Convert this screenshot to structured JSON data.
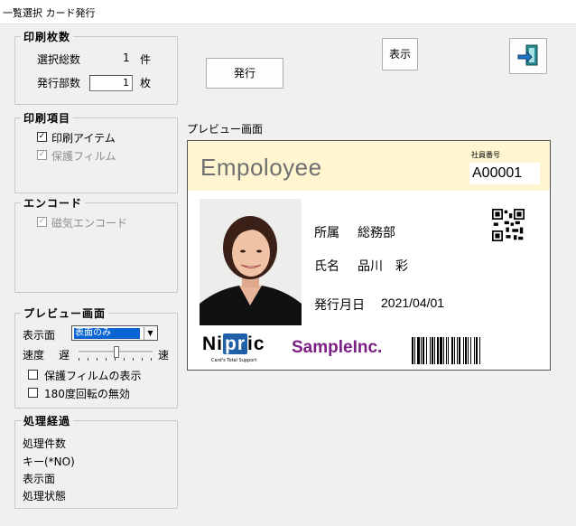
{
  "window": {
    "title": "一覧選択 カード発行"
  },
  "print_count": {
    "title": "印刷枚数",
    "total_label": "選択総数",
    "total_value": "1",
    "total_unit": "件",
    "copies_label": "発行部数",
    "copies_value": "1",
    "copies_unit": "枚"
  },
  "print_items": {
    "title": "印刷項目",
    "items": [
      {
        "label": "印刷アイテム",
        "checked": true,
        "enabled": true
      },
      {
        "label": "保護フィルム",
        "checked": true,
        "enabled": false
      }
    ]
  },
  "encode": {
    "title": "エンコード",
    "items": [
      {
        "label": "磁気エンコード",
        "checked": true,
        "enabled": false
      }
    ]
  },
  "preview_settings": {
    "title": "プレビュー画面",
    "side_label": "表示面",
    "side_value": "表面のみ",
    "speed_label": "速度",
    "speed_slow": "遅",
    "speed_fast": "速",
    "speed_level": 0.5,
    "options": [
      {
        "label": "保護フィルムの表示",
        "checked": false
      },
      {
        "label": "180度回転の無効",
        "checked": false
      }
    ]
  },
  "process_log": {
    "title": "処理経過",
    "lines": [
      "処理件数",
      "キー(*NO)",
      "表示面",
      "処理状態"
    ]
  },
  "buttons": {
    "issue": "発行",
    "display": "表示",
    "exit_icon": "exit-door-icon"
  },
  "preview": {
    "label": "プレビュー画面",
    "card": {
      "header_color": "#fff6d1",
      "title": "Empoloyee",
      "employee_no_label": "社員番号",
      "employee_no": "A00001",
      "dept_label": "所属",
      "dept_value": "総務部",
      "name_label": "氏名",
      "name_value": "品川　彩",
      "issue_date_label": "発行月日",
      "issue_date": "2021/04/01",
      "logo_left": "Ni",
      "logo_mid": "pr",
      "logo_right": "ic",
      "logo_tagline": "Card's Total Support",
      "company": "SampleInc.",
      "company_color": "#7b1f86",
      "icons": [
        "qr-code-icon",
        "barcode-icon",
        "photo-portrait"
      ]
    }
  }
}
